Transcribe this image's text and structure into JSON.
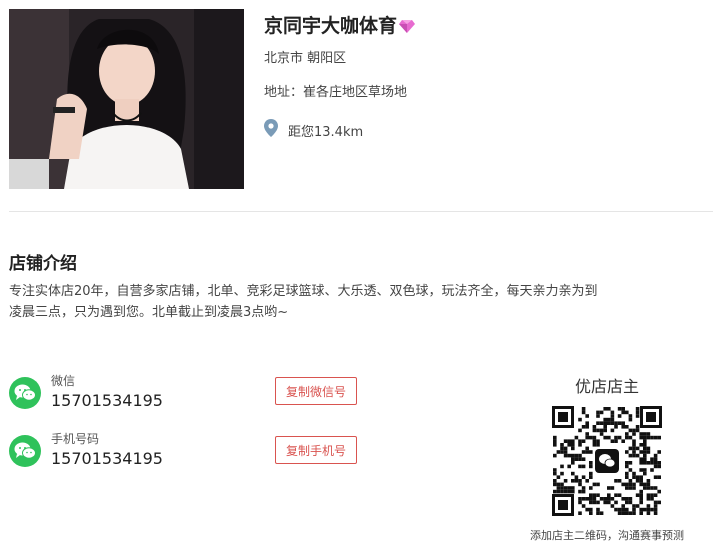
{
  "store": {
    "name": "京同宇大咖体育",
    "city": "北京市 朝阳区",
    "address": "地址：崔各庄地区草场地",
    "distance": "距您13.4km"
  },
  "intro": {
    "title": "店铺介绍",
    "text": "专注实体店20年，自营多家店铺，北单、竞彩足球篮球、大乐透、双色球，玩法齐全，每天亲力亲为到凌晨三点，只为遇到您。北单截止到凌晨3点哟~"
  },
  "contacts": {
    "wechat": {
      "label": "微信",
      "value": "15701534195",
      "copy_label": "复制微信号"
    },
    "phone": {
      "label": "手机号码",
      "value": "15701534195",
      "copy_label": "复制手机号"
    }
  },
  "qr": {
    "title": "优店店主",
    "caption": "添加店主二维码，沟通赛事预测"
  },
  "colors": {
    "accent_red": "#d9534f",
    "wechat_green": "#2fc25b",
    "pin_blue": "#7a9bb7"
  },
  "icons": [
    "gem-icon",
    "location-pin-icon",
    "wechat-icon",
    "qr-code"
  ]
}
